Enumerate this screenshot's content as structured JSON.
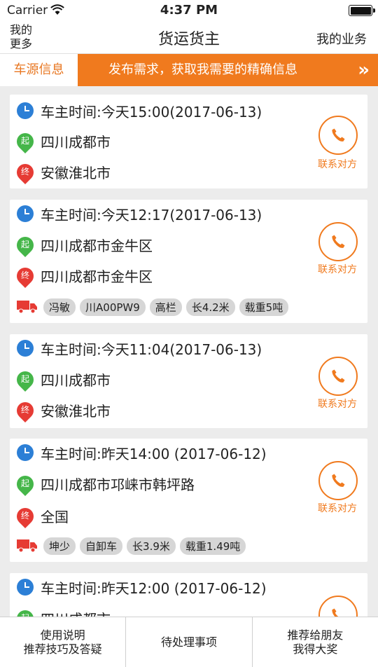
{
  "status_bar": {
    "carrier": "Carrier",
    "time": "4:37 PM"
  },
  "nav": {
    "left_label": "我的\n更多",
    "title": "货运货主",
    "right_label": "我的业务"
  },
  "banner": {
    "tab_label": "车源信息",
    "promo_text": "发布需求，获取我需要的精确信息",
    "arrow": "»"
  },
  "contact_label": "联系对方",
  "cards": [
    {
      "time": "车主时间:今天15:00(2017-06-13)",
      "origin": "四川成都市",
      "destination": "安徽淮北市",
      "tags": []
    },
    {
      "time": "车主时间:今天12:17(2017-06-13)",
      "origin": "四川成都市金牛区",
      "destination": "四川成都市金牛区",
      "tags": [
        "冯敏",
        "川A00PW9",
        "高栏",
        "长4.2米",
        "载重5吨"
      ]
    },
    {
      "time": "车主时间:今天11:04(2017-06-13)",
      "origin": "四川成都市",
      "destination": "安徽淮北市",
      "tags": []
    },
    {
      "time": "车主时间:昨天14:00 (2017-06-12)",
      "origin": "四川成都市邛崃市韩坪路",
      "destination": "全国",
      "tags": [
        "坤少",
        "自卸车",
        "长3.9米",
        "载重1.49吨"
      ]
    },
    {
      "time": "车主时间:昨天12:00 (2017-06-12)",
      "origin": "四川成都市",
      "destination": "",
      "tags": []
    }
  ],
  "pin_labels": {
    "start": "起",
    "end": "终"
  },
  "bottom_tabs": [
    {
      "label": "使用说明\n推荐技巧及答疑"
    },
    {
      "label": "待处理事项"
    },
    {
      "label": "推荐给朋友\n我得大奖"
    }
  ],
  "colors": {
    "accent": "#f07a1e",
    "clock": "#2c7fd6",
    "start_pin": "#45b649",
    "end_pin": "#e63b34",
    "truck": "#e63b34"
  }
}
